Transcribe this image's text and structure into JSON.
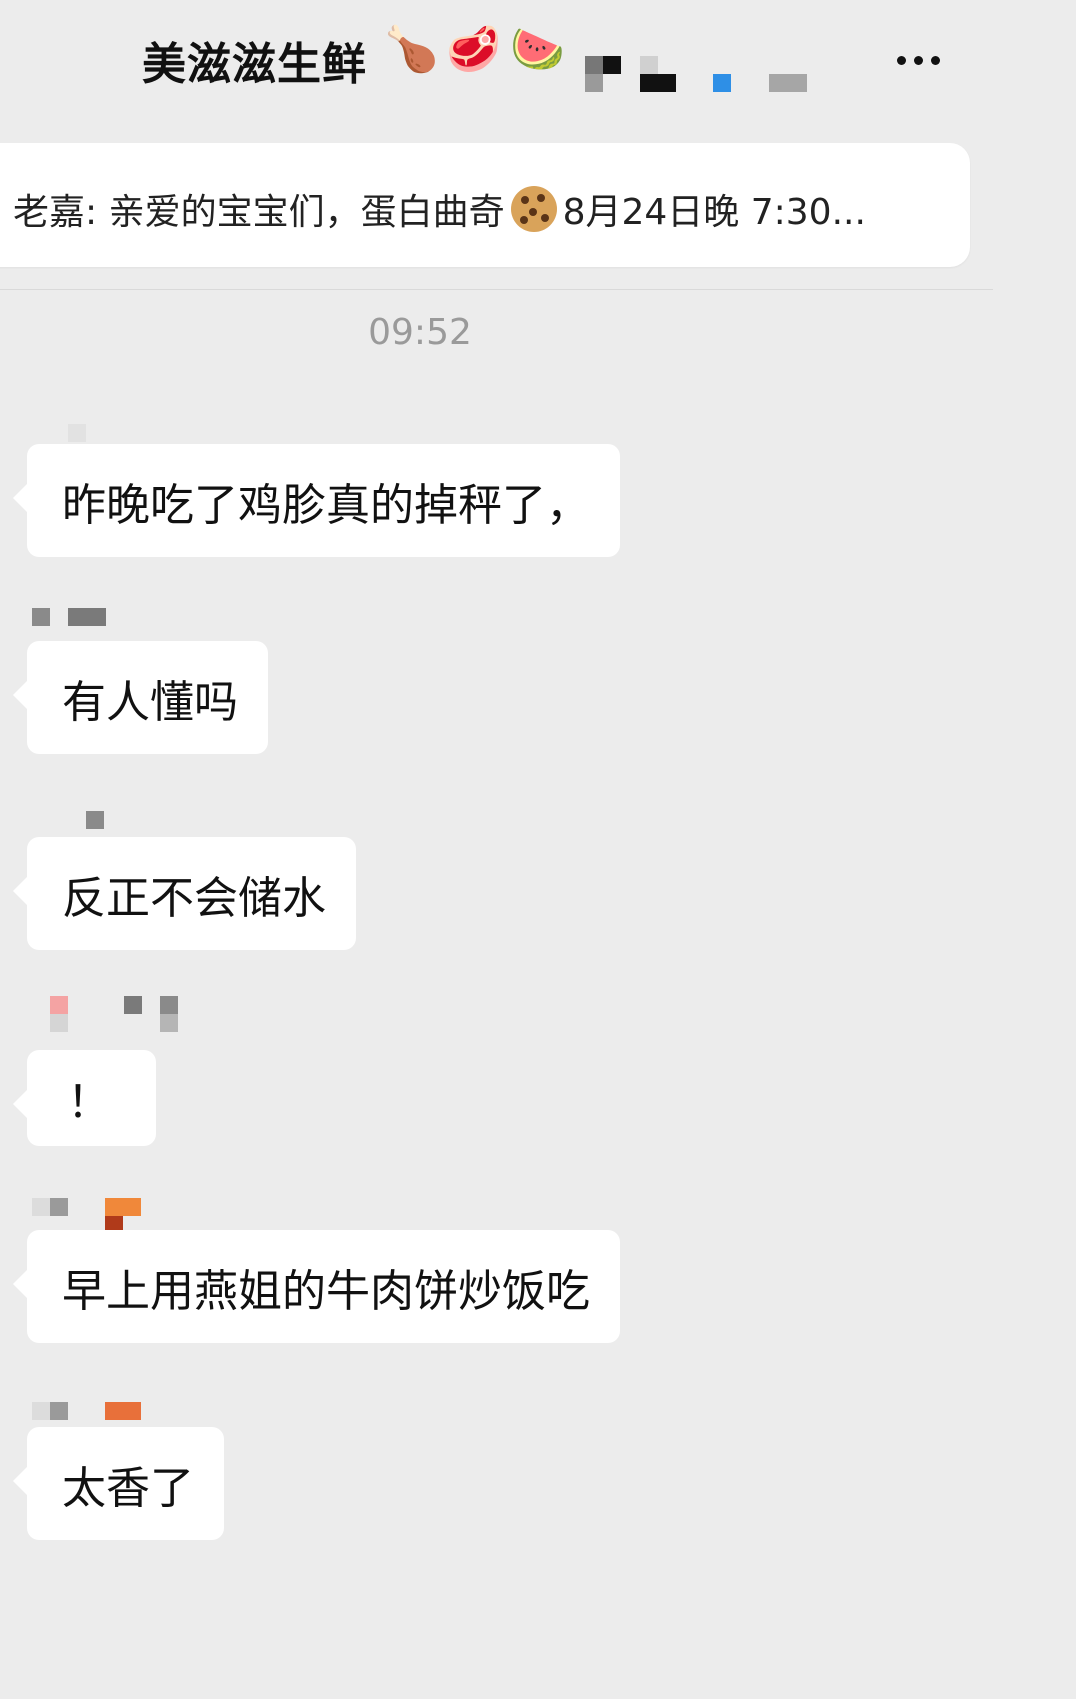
{
  "header": {
    "title": "美滋滋生鲜",
    "title_emojis": [
      "🍗",
      "🥩",
      "🍉"
    ],
    "more_icon": "more-dots-icon"
  },
  "pinned": {
    "text_before_emoji": "老嘉: 亲爱的宝宝们，蛋白曲奇",
    "emoji": "🍪",
    "text_after_emoji": "8月24日晚 7:30..."
  },
  "chat": {
    "timestamp": "09:52",
    "messages": [
      {
        "text": "昨晚吃了鸡胗真的掉秤了，"
      },
      {
        "text": "有人懂吗"
      },
      {
        "text": "反正不会储水"
      },
      {
        "text": "！"
      },
      {
        "text": "早上用燕姐的牛肉饼炒饭吃"
      },
      {
        "text": "太香了"
      }
    ]
  },
  "colors": {
    "background": "#ececec",
    "bubble": "#ffffff",
    "timestamp": "#9a9a9a"
  }
}
